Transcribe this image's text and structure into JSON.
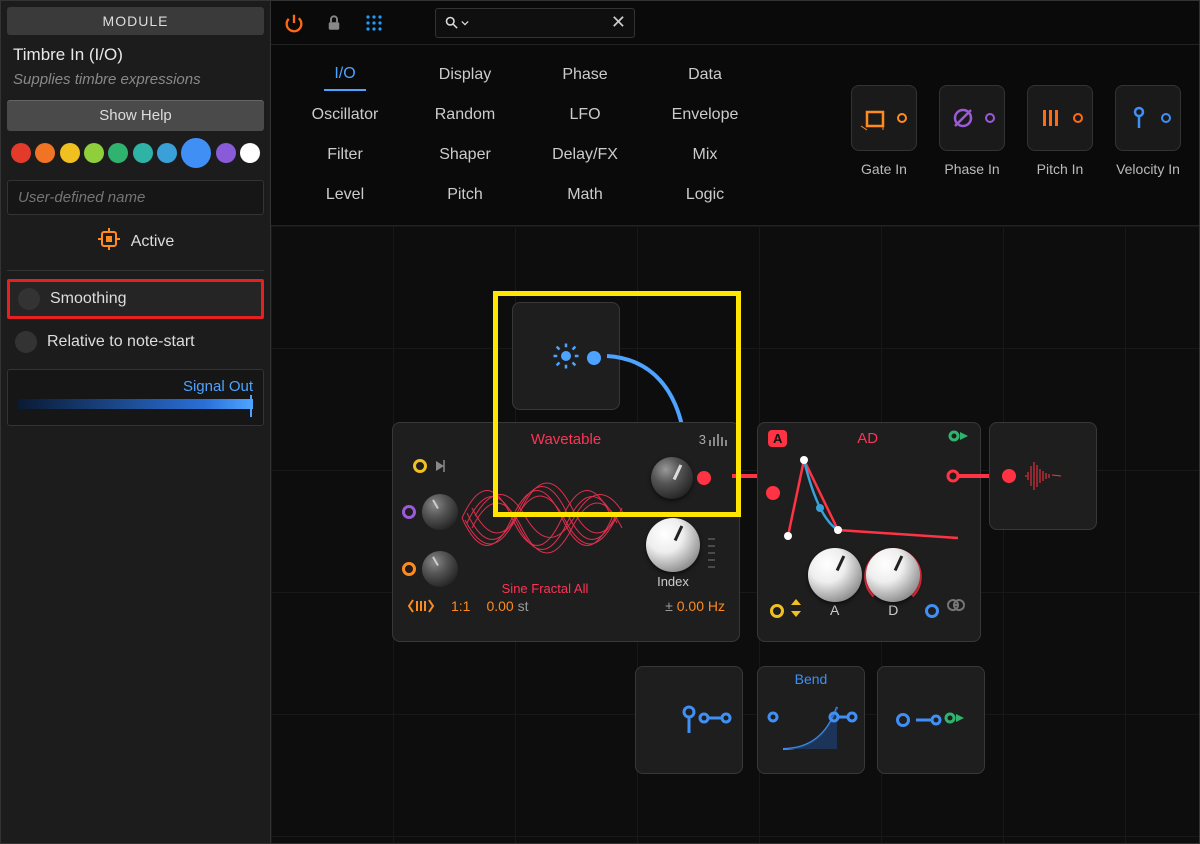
{
  "sidebar": {
    "header": "MODULE",
    "title": "Timbre In (I/O)",
    "subtitle": "Supplies timbre expressions",
    "help_label": "Show Help",
    "colors": [
      "#e23b2a",
      "#f07423",
      "#f0c020",
      "#8fcf3c",
      "#2fb36e",
      "#2fb3a6",
      "#3aa0d8",
      "#3f8ff5",
      "#8a5bd8",
      "#ffffff"
    ],
    "selected_color_index": 7,
    "name_placeholder": "User-defined name",
    "active_label": "Active",
    "smoothing_label": "Smoothing",
    "relative_label": "Relative to note-start",
    "signal_out_label": "Signal Out"
  },
  "toolbar": {
    "power_color": "#ff6a13",
    "grid_color": "#1f9dff"
  },
  "categories": [
    [
      "I/O",
      "Display",
      "Phase",
      "Data"
    ],
    [
      "Oscillator",
      "Random",
      "LFO",
      "Envelope"
    ],
    [
      "Filter",
      "Shaper",
      "Delay/FX",
      "Mix"
    ],
    [
      "Level",
      "Pitch",
      "Math",
      "Logic"
    ]
  ],
  "active_category": "I/O",
  "input_modules": [
    {
      "label": "Gate In",
      "color": "#ff8a1f",
      "icon": "gate"
    },
    {
      "label": "Phase In",
      "color": "#9b5bd8",
      "icon": "phase"
    },
    {
      "label": "Pitch In",
      "color": "#ff6a13",
      "icon": "pitch"
    },
    {
      "label": "Velocity In",
      "color": "#3f8ff5",
      "icon": "velocity"
    }
  ],
  "wavetable": {
    "title": "Wavetable",
    "voices": "3",
    "preset": "Sine Fractal All",
    "index_label": "Index",
    "ratio": "1:1",
    "pitch_offset": "0.00",
    "pitch_unit": "st",
    "freq_prefix": "±",
    "freq": "0.00 Hz"
  },
  "ad": {
    "title": "AD",
    "a_label": "A",
    "d_label": "D"
  },
  "bend": {
    "title": "Bend"
  }
}
